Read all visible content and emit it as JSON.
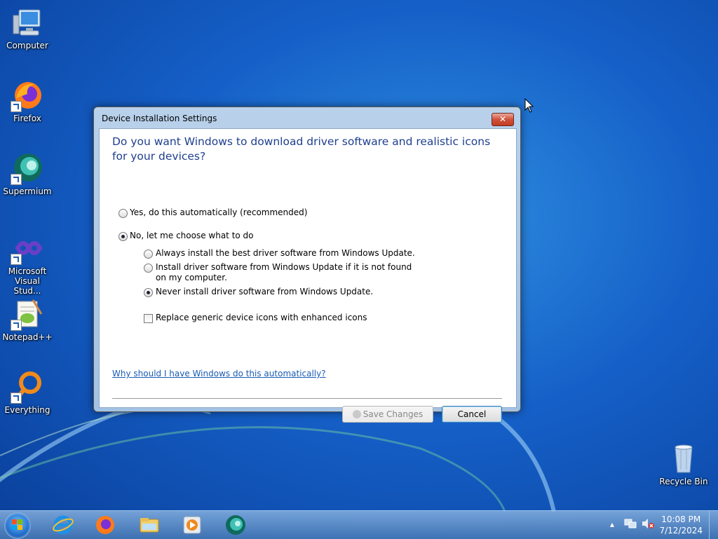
{
  "desktop": {
    "icons": [
      {
        "label": "Computer"
      },
      {
        "label": "Firefox"
      },
      {
        "label": "Supermium"
      },
      {
        "label": "Microsoft Visual Stud..."
      },
      {
        "label": "Notepad++"
      },
      {
        "label": "Everything"
      },
      {
        "label": "Recycle Bin"
      }
    ]
  },
  "dialog": {
    "title": "Device Installation Settings",
    "close_label": "✕",
    "heading": "Do you want Windows to download driver software and realistic icons for your devices?",
    "options": [
      {
        "label": "Yes, do this automatically (recommended)",
        "selected": false
      },
      {
        "label": "No, let me choose what to do",
        "selected": true
      }
    ],
    "sub_options": [
      {
        "label": "Always install the best driver software from Windows Update.",
        "selected": false
      },
      {
        "label": "Install driver software from Windows Update if it is not found on my computer.",
        "selected": false
      },
      {
        "label": "Never install driver software from Windows Update.",
        "selected": true
      }
    ],
    "checkbox_label": "Replace generic device icons with enhanced icons",
    "checkbox_checked": false,
    "help_link": "Why should I have Windows do this automatically?",
    "save_label": "Save Changes",
    "cancel_label": "Cancel"
  },
  "taskbar": {
    "pinned": [
      "internet-explorer-icon",
      "firefox-icon",
      "file-explorer-icon",
      "media-player-icon",
      "supermium-icon"
    ],
    "time": "10:08 PM",
    "date": "7/12/2024"
  },
  "colors": {
    "heading": "#1e3f8f",
    "link": "#1a5bb4",
    "close": "#c23b22"
  }
}
